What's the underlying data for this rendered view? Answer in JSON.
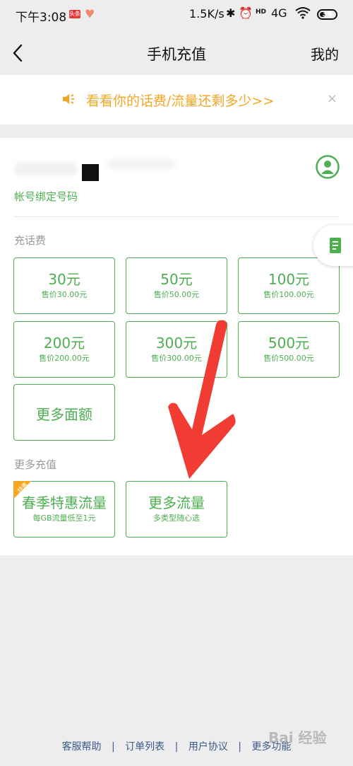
{
  "status_bar": {
    "time": "下午3:08",
    "badge": "头条",
    "network_speed": "1.5K/s",
    "network": "4G",
    "battery": "39"
  },
  "nav": {
    "title": "手机充值",
    "right_label": "我的"
  },
  "banner": {
    "text": "看看你的话费/流量还剩多少>>",
    "close_glyph": "×",
    "accent_color": "#f5a623"
  },
  "account": {
    "bind_label": "帐号绑定号码"
  },
  "topup": {
    "section_title": "充话费",
    "items": [
      {
        "amount": "30元",
        "price": "售价30.00元"
      },
      {
        "amount": "50元",
        "price": "售价50.00元"
      },
      {
        "amount": "100元",
        "price": "售价100.00元"
      },
      {
        "amount": "200元",
        "price": "售价200.00元"
      },
      {
        "amount": "300元",
        "price": "售价300.00元"
      },
      {
        "amount": "500元",
        "price": "售价500.00元"
      }
    ],
    "more_label": "更多面额"
  },
  "more_recharge": {
    "section_title": "更多充值",
    "items": [
      {
        "title": "春季特惠流量",
        "subtitle": "每GB流量低至1元",
        "tag": "特惠"
      },
      {
        "title": "更多流量",
        "subtitle": "多类型随心选"
      }
    ]
  },
  "footer": {
    "links": [
      "客服帮助",
      "订单列表",
      "用户协议",
      "更多功能"
    ],
    "separator": "|"
  },
  "watermark": "Bai 经验",
  "colors": {
    "brand_green": "#4caf50",
    "background": "#ededed",
    "arrow_red": "#f03c32"
  },
  "icons": {
    "back": "chevron-left-icon",
    "speaker": "speaker-icon",
    "account": "user-circle-icon",
    "side_tab": "document-icon"
  }
}
